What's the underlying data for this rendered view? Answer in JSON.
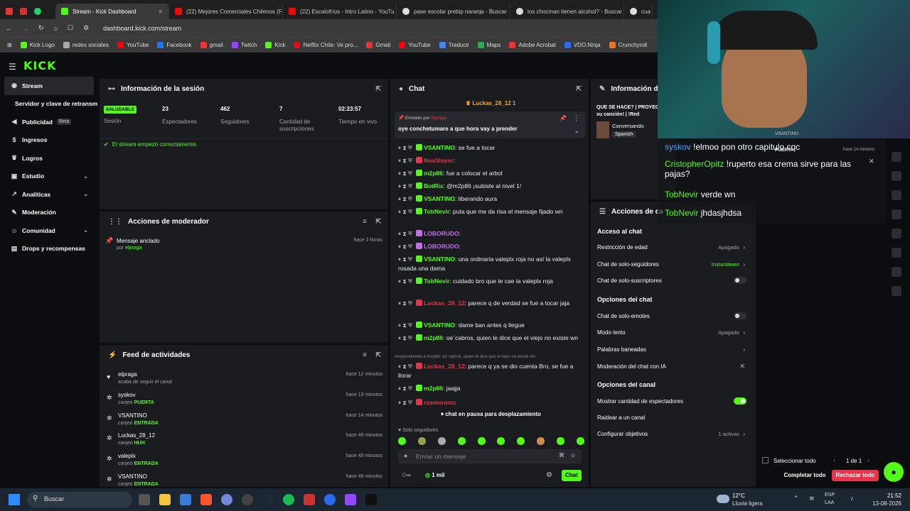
{
  "browser": {
    "tabs": [
      {
        "label": "Stream - Kick Dashboard",
        "active": true
      },
      {
        "label": "(22) Mejores Comerciales Chilenos (F"
      },
      {
        "label": "(22) Escalofríos - Intro Latino - YouTu"
      },
      {
        "label": "pase escolar prebip naranja - Buscar"
      },
      {
        "label": "los chocman tienen alcohol? - Buscar"
      },
      {
        "label": "cua"
      }
    ],
    "url": "dashboard.kick.com/stream",
    "bookmarks": [
      "Kick Logo",
      "redes sociales",
      "YouTube",
      "Facebook",
      "gmail",
      "Twitch",
      "Kick",
      "Netflix Chile: Ve pro...",
      "Gmail",
      "YouTube",
      "Traducir",
      "Maps",
      "Adobe Acrobat",
      "VDO.Ninja",
      "Crunchyroll"
    ]
  },
  "colors": {
    "accent": "#53fc18",
    "panel": "#191b1f",
    "bg": "#0b0e0f",
    "red": "#e8334a"
  },
  "app": {
    "logo": "KICK"
  },
  "sidebar": {
    "items": [
      {
        "label": "Stream",
        "active": true,
        "icon": "broadcast-icon"
      },
      {
        "label": "Servidor y clave de retransm"
      },
      {
        "label": "Publicidad",
        "badge": "Beta",
        "icon": "megaphone-icon"
      },
      {
        "label": "Ingresos",
        "icon": "dollar-icon"
      },
      {
        "label": "Logros",
        "icon": "trophy-icon"
      },
      {
        "label": "Estudio",
        "icon": "studio-icon",
        "chev": true
      },
      {
        "label": "Analíticas",
        "icon": "chart-icon",
        "chev": true
      },
      {
        "label": "Moderación",
        "icon": "wrench-icon"
      },
      {
        "label": "Comunidad",
        "icon": "users-icon",
        "chev": true
      },
      {
        "label": "Drops y recompensas",
        "icon": "gift-icon"
      }
    ]
  },
  "session": {
    "title": "Información de la sesión",
    "status": "SALUDABLE",
    "status_label": "Sesión",
    "stats": [
      {
        "value": "23",
        "label": "Espectadores"
      },
      {
        "value": "462",
        "label": "Seguidores"
      },
      {
        "value": "7",
        "label": "Cantidad de suscripciones"
      },
      {
        "value": "02:23:57",
        "label": "Tiempo en vivo"
      }
    ],
    "message": "El stream empezó correctamente."
  },
  "mod_actions": {
    "title": "Acciones de moderador",
    "item": "Mensaje anclado",
    "by_prefix": "por",
    "by_user": "elpraga",
    "time": "hace 3 horas"
  },
  "feed": {
    "title": "Feed de actividades",
    "items": [
      {
        "name": "elpraga",
        "desc": "acaba de seguir el canal",
        "reward": "",
        "time": "hace 12 minutos",
        "icon": "heart-icon"
      },
      {
        "name": "syskov",
        "desc": "canjeó",
        "reward": "PUERTA",
        "time": "hace 13 minutos",
        "icon": "reward-icon"
      },
      {
        "name": "VSANTINO",
        "desc": "canjeó",
        "reward": "ENTRADA",
        "time": "hace 14 minutos",
        "icon": "reward-icon"
      },
      {
        "name": "Luckas_28_12",
        "desc": "canjeó",
        "reward": "HUH",
        "time": "hace 49 minutos",
        "icon": "reward-icon"
      },
      {
        "name": "valeplx",
        "desc": "canjeó",
        "reward": "ENTRADA",
        "time": "hace 49 minutos",
        "icon": "reward-icon"
      },
      {
        "name": "VSANTINO",
        "desc": "canjeó",
        "reward": "ENTRADA",
        "time": "hace 49 minutos",
        "icon": "reward-icon"
      }
    ]
  },
  "chat": {
    "title": "Chat",
    "top_user": "Luckas_28_12",
    "top_count": "1",
    "pinned_label": "Enviado por",
    "pinned_user": "elpraga",
    "pinned_text": "oye conchetumare a que hora vay a prender",
    "messages": [
      {
        "user": "VSANTINO",
        "color": "#53fc18",
        "text": ": se fue a tocar"
      },
      {
        "user": "NoxSlayer",
        "color": "#e8334a",
        "text": ":"
      },
      {
        "user": "m2p86",
        "color": "#53fc18",
        "text": ": fue a colocar el arbol"
      },
      {
        "user": "BotRix",
        "color": "#53fc18",
        "text": ": @m2p86 ¡subiste al nivel 1!"
      },
      {
        "user": "VSANTINO",
        "color": "#53fc18",
        "text": ": liberando aura"
      },
      {
        "user": "TobNevir",
        "color": "#53fc18",
        "text": ": puta que me da risa el mensaje fijado wn"
      },
      {
        "user": "LOBORUDO",
        "color": "#c56cf0",
        "text": ":"
      },
      {
        "user": "LOBORUDO",
        "color": "#c56cf0",
        "text": ":"
      },
      {
        "user": "VSANTINO",
        "color": "#53fc18",
        "text": ": una ordinaria valeplx roja no así la valeplx rosada una dama"
      },
      {
        "user": "TobNevir",
        "color": "#53fc18",
        "text": ": cuidado bro que te cae la valeplx roja"
      },
      {
        "user": "Luckas_28_12",
        "color": "#e8334a",
        "text": ": parece q de verdad se fue a tocar jaja"
      },
      {
        "user": "VSANTINO",
        "color": "#53fc18",
        "text": ": dame ban antes q llegue"
      },
      {
        "user": "m2p86",
        "color": "#53fc18",
        "text": ": oe¨cabros, quien le dice que el viejo no existe wn"
      },
      {
        "user": "Luckas_28_12",
        "color": "#e8334a",
        "text": ": parece q ya se dio cuenta Bro, se fue a llorar"
      },
      {
        "user": "m2p86",
        "color": "#53fc18",
        "text": ": jaajja"
      },
      {
        "user": "rzamorano",
        "color": "#e8334a",
        "text": ":"
      }
    ],
    "reply_note": "Respondiendo a m2p86: oe¨cabros, quien le dice que el viejo no existe wn",
    "paused": "chat en pausa para desplazamiento",
    "followers_only": "Solo seguidores",
    "input_placeholder": "Enviar un mensaje",
    "points": "1 mil",
    "send": "Chat"
  },
  "info": {
    "title": "Información de",
    "stream_title": "QUE SE HACE? | PROYEC poner su canción! | !Red",
    "category": "Conversando",
    "lang": "Spanish"
  },
  "channel_actions": {
    "title": "Acciones de ca",
    "sections": [
      {
        "title": "Acceso al chat",
        "rows": [
          {
            "label": "Restricción de edad",
            "value": "Apagado",
            "kind": "link"
          },
          {
            "label": "Chat de solo-seguidores",
            "value": "Instantáneo",
            "kind": "link"
          },
          {
            "label": "Chat de solo-suscriptores",
            "value": "",
            "kind": "toggle",
            "on": false
          }
        ]
      },
      {
        "title": "Opciones del chat",
        "rows": [
          {
            "label": "Chat de solo-emotes",
            "value": "",
            "kind": "toggle",
            "on": false
          },
          {
            "label": "Modo lento",
            "value": "Apagado",
            "kind": "link"
          },
          {
            "label": "Palabras baneadas",
            "value": "",
            "kind": "link"
          },
          {
            "label": "Moderación del chat con IA",
            "value": "",
            "kind": "ext"
          }
        ]
      },
      {
        "title": "Opciones del canal",
        "rows": [
          {
            "label": "Mostrar cantidad de espectadores",
            "value": "",
            "kind": "toggle",
            "on": true
          },
          {
            "label": "Raidear a un canal",
            "value": "",
            "kind": "none"
          },
          {
            "label": "Configurar objetivos",
            "value": "1 activas",
            "kind": "link"
          }
        ]
      }
    ]
  },
  "overlay": {
    "messages": [
      {
        "user": "syskov",
        "text": "!elmoo pon otro capitulo cqc",
        "color": "#4fa3ff"
      },
      {
        "user": "CristopherOpitz",
        "text": "!ruperto esa crema sirve para las pajas?",
        "color": "#53fc18"
      },
      {
        "user": "TobNevir",
        "text": "verde wn",
        "color": "#53fc18"
      },
      {
        "user": "TobNevir",
        "text": "jhdasjhdsa",
        "color": "#53fc18"
      }
    ],
    "notif_user": "VSANTINO",
    "notif_reward": "PUERTA",
    "notif_time": "hace 14 minutos"
  },
  "redemptions": {
    "select_all": "Seleccionar todo",
    "pager": "1 de 1",
    "complete": "Completar todo",
    "reject": "Rechazar todo"
  },
  "taskbar": {
    "search": "Buscar",
    "weather_temp": "12°C",
    "weather_desc": "Lluvia ligera",
    "lang1": "ESP",
    "lang2": "LAA",
    "time": "21:52",
    "date": "13-08-2026"
  }
}
